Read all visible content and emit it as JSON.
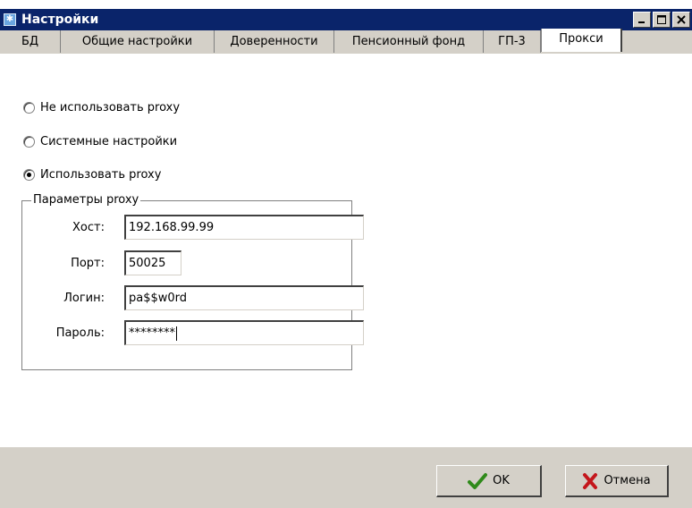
{
  "window": {
    "title": "Настройки",
    "app_icon": "settings-app-icon",
    "title_buttons": [
      "minimize-icon",
      "maximize-icon",
      "close-icon"
    ]
  },
  "tabs": [
    {
      "label": "БД",
      "active": false
    },
    {
      "label": "Общие настройки",
      "active": false
    },
    {
      "label": "Доверенности",
      "active": false
    },
    {
      "label": "Пенсионный фонд",
      "active": false
    },
    {
      "label": "ГП-3",
      "active": false
    },
    {
      "label": "Прокси",
      "active": true
    }
  ],
  "proxy_mode": {
    "options": [
      {
        "label": "Не использовать proxy",
        "checked": false
      },
      {
        "label": "Системные настройки",
        "checked": false
      },
      {
        "label": "Использовать proxy",
        "checked": true
      }
    ]
  },
  "proxy_params": {
    "title": "Параметры proxy",
    "host": {
      "label": "Хост:",
      "value": "192.168.99.99"
    },
    "port": {
      "label": "Порт:",
      "value": "50025"
    },
    "login": {
      "label": "Логин:",
      "value": "pa$$w0rd"
    },
    "password": {
      "label": "Пароль:",
      "value": "********"
    }
  },
  "buttons": {
    "ok_label": "OK",
    "cancel_label": "Отмена"
  },
  "colors": {
    "titlebar": "#0a246a",
    "ok_check": "#2f8a1a",
    "cancel_x": "#c4161c"
  }
}
